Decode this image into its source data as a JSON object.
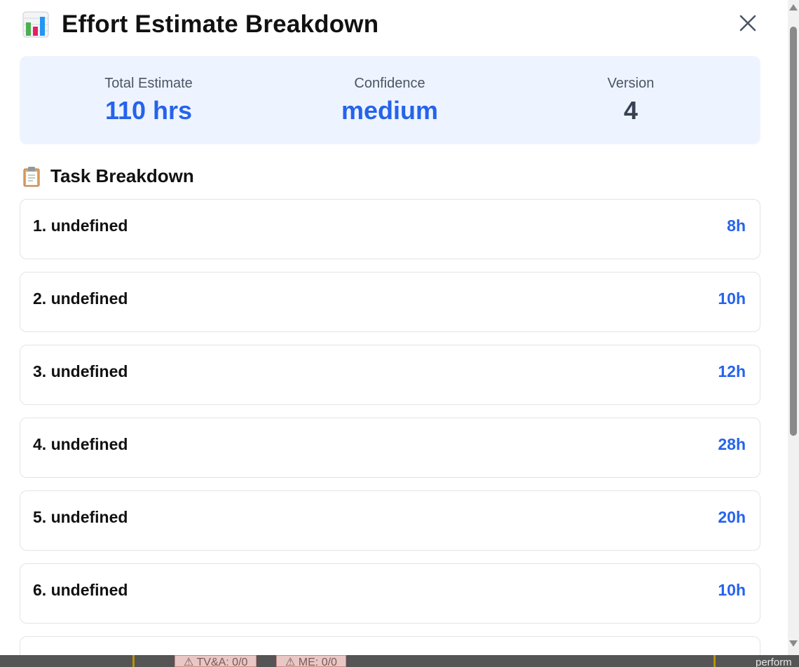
{
  "modal": {
    "title": "Effort Estimate Breakdown",
    "title_icon": "bar-chart-icon",
    "close_icon": "close-icon"
  },
  "summary": {
    "total_label": "Total Estimate",
    "total_value": "110 hrs",
    "confidence_label": "Confidence",
    "confidence_value": "medium",
    "version_label": "Version",
    "version_value": "4"
  },
  "section": {
    "title": "Task Breakdown",
    "icon": "clipboard-icon"
  },
  "tasks": [
    {
      "label": "1. undefined",
      "hours": "8h"
    },
    {
      "label": "2. undefined",
      "hours": "10h"
    },
    {
      "label": "3. undefined",
      "hours": "12h"
    },
    {
      "label": "4. undefined",
      "hours": "28h"
    },
    {
      "label": "5. undefined",
      "hours": "20h"
    },
    {
      "label": "6. undefined",
      "hours": "10h"
    }
  ],
  "background": {
    "badge_1": "TV&A: 0/0",
    "badge_2": "ME: 0/0",
    "trailing_text": "perform"
  },
  "colors": {
    "accent": "#2563eb",
    "summary_bg": "#eef4ff",
    "text_dark": "#374151"
  }
}
